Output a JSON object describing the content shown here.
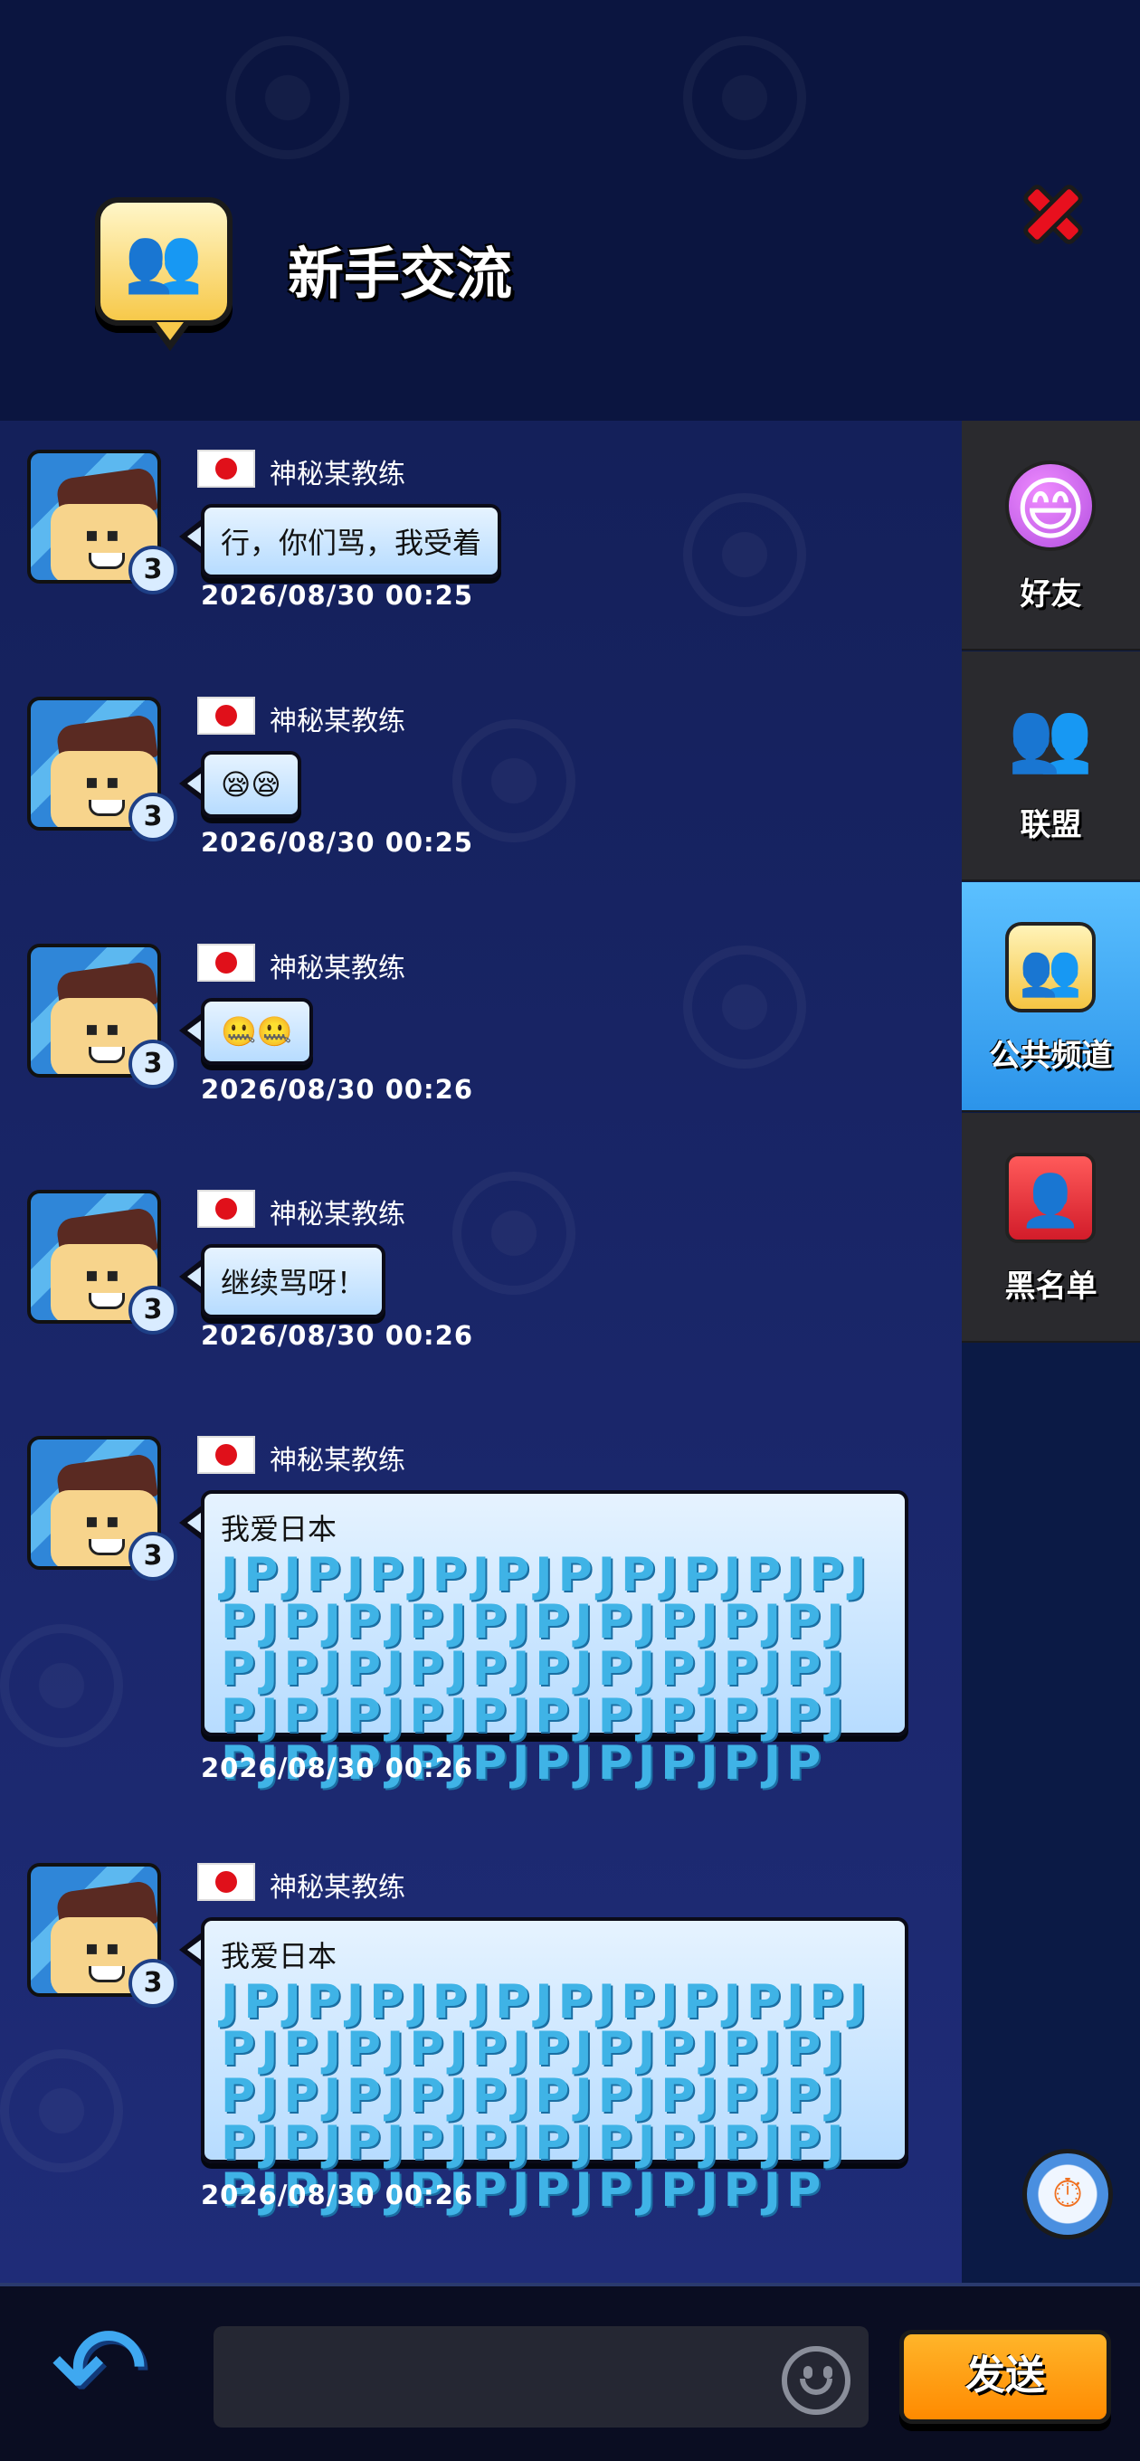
{
  "header": {
    "title": "新手交流",
    "icon": "group-chat-icon",
    "close_icon": "close-icon"
  },
  "sidebar": {
    "tabs": [
      {
        "label": "好友",
        "icon": "friends-icon",
        "glyph": "😄",
        "active": false
      },
      {
        "label": "联盟",
        "icon": "league-icon",
        "glyph": "👥",
        "active": false
      },
      {
        "label": "公共频道",
        "icon": "public-channel-icon",
        "glyph": "👥",
        "active": true
      },
      {
        "label": "黑名单",
        "icon": "blacklist-icon",
        "glyph": "👤",
        "active": false
      }
    ],
    "timer_icon": "stopwatch-icon"
  },
  "messages": [
    {
      "user": "神秘某教练",
      "level": "3",
      "flag": "japan-flag",
      "text": "行，你们骂，我受着",
      "jp": "",
      "time": "2026/08/30 00:25"
    },
    {
      "user": "神秘某教练",
      "level": "3",
      "flag": "japan-flag",
      "text": "😪😪",
      "jp": "",
      "time": "2026/08/30 00:25"
    },
    {
      "user": "神秘某教练",
      "level": "3",
      "flag": "japan-flag",
      "text": "🤐🤐",
      "jp": "",
      "time": "2026/08/30 00:26"
    },
    {
      "user": "神秘某教练",
      "level": "3",
      "flag": "japan-flag",
      "text": "继续骂呀！",
      "jp": "",
      "time": "2026/08/30 00:26"
    },
    {
      "user": "神秘某教练",
      "level": "3",
      "flag": "japan-flag",
      "text": "我爱日本",
      "jp": "JPJPJPJPJPJPJPJPJPJPJPJPJPJPJPJPJPJPJPJPJPJPJPJPJPJPJPJPJPJPJPJPJPJPJPJPJPJPJPJPJPJPJPJPJPJPJPJPJPJP",
      "time": "2026/08/30 00:26"
    },
    {
      "user": "神秘某教练",
      "level": "3",
      "flag": "japan-flag",
      "text": "我爱日本",
      "jp": "JPJPJPJPJPJPJPJPJPJPJPJPJPJPJPJPJPJPJPJPJPJPJPJPJPJPJPJPJPJPJPJPJPJPJPJPJPJPJPJPJPJPJPJPJPJPJPJPJPJP",
      "time": "2026/08/30 00:26"
    }
  ],
  "input": {
    "value": "",
    "placeholder": "",
    "emoji_icon": "emoji-icon"
  },
  "bottom": {
    "back_icon": "back-arrow-icon",
    "send_label": "发送"
  },
  "colors": {
    "header_bg": "#0b1540",
    "active_tab": "#3aa6f2",
    "send_button": "#ff9a10",
    "bubble": "#cde6ff",
    "jp_text": "#3fb3e6"
  }
}
